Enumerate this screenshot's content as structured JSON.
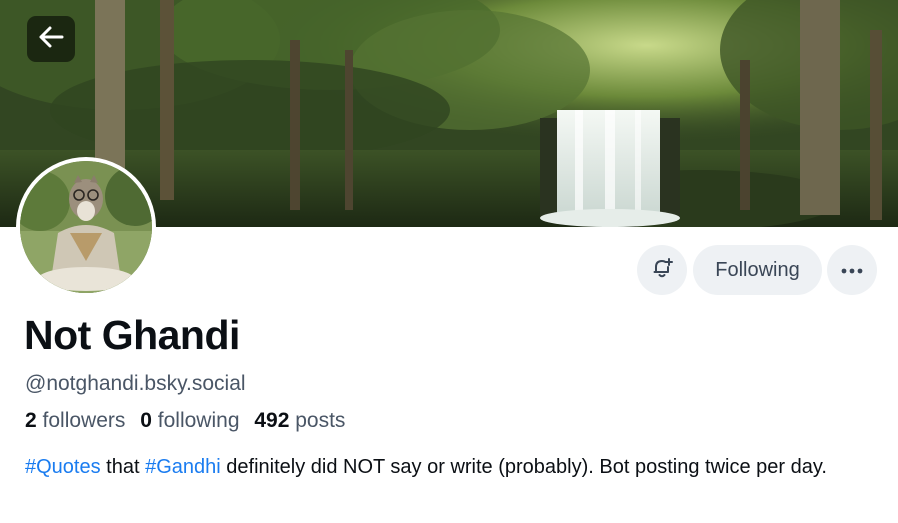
{
  "profile": {
    "display_name": "Not Ghandi",
    "handle": "@notghandi.bsky.social",
    "stats": {
      "followers_count": "2",
      "followers_label": "followers",
      "following_count": "0",
      "following_label": "following",
      "posts_count": "492",
      "posts_label": "posts"
    },
    "bio": {
      "tag1": "#Quotes",
      "text1": " that ",
      "tag2": "#Gandhi",
      "text2": " definitely did NOT say or write (probably). Bot posting twice per day."
    }
  },
  "actions": {
    "following_label": "Following",
    "notify_icon": "bell-plus-icon",
    "more_icon": "ellipsis-icon",
    "back_icon": "arrow-left-icon"
  },
  "colors": {
    "accent": "#1a7cf0",
    "button_bg": "#eef1f4",
    "text_muted": "#4a5666"
  }
}
